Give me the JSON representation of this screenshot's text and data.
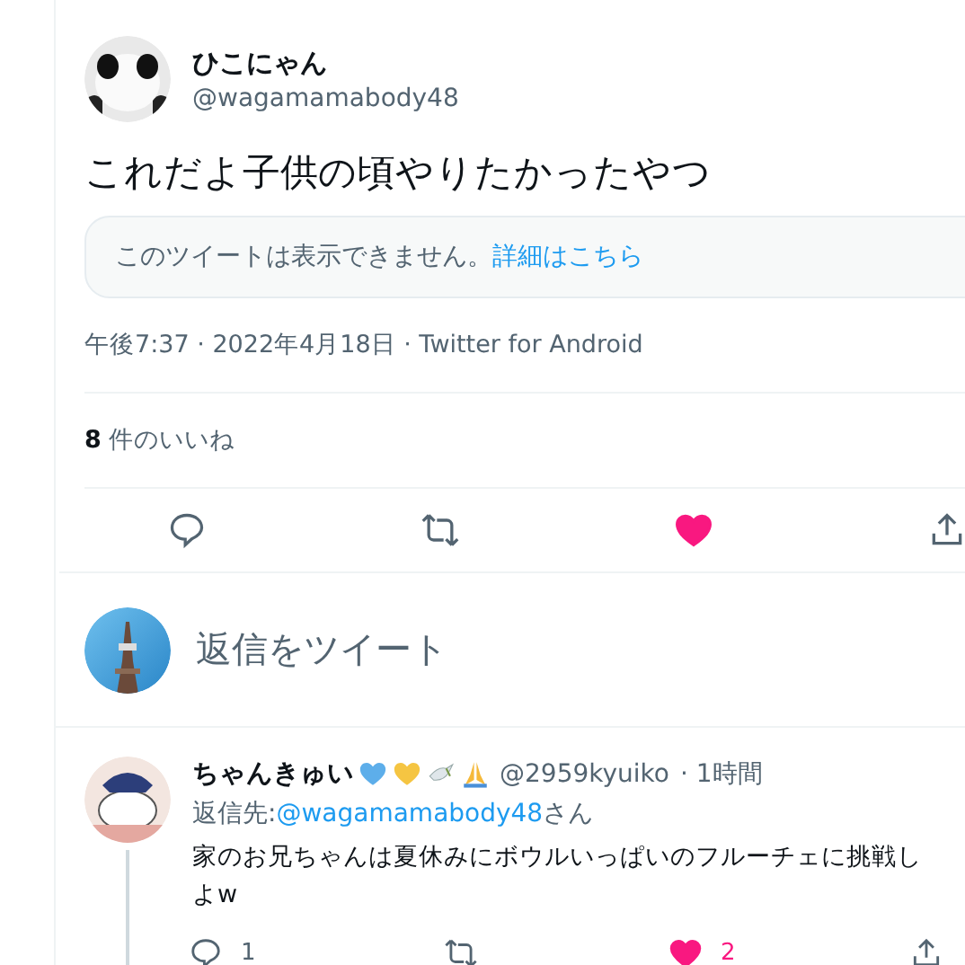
{
  "tweet": {
    "author": {
      "name": "ひこにゃん",
      "handle": "@wagamamabody48"
    },
    "text": "これだよ子供の頃やりたかったやつ",
    "quote_card": {
      "message": "このツイートは表示できません。",
      "link": "詳細はこちら"
    },
    "meta": "午後7:37 · 2022年4月18日 · Twitter for Android",
    "likes": {
      "count": "8",
      "label": "件のいいね"
    },
    "actions": {
      "liked": true
    }
  },
  "composer": {
    "placeholder": "返信をツイート"
  },
  "reply": {
    "author": {
      "name": "ちゃんきゅい",
      "handle": "@2959kyuiko",
      "time": "· 1時間"
    },
    "reply_to": {
      "label": "返信先:",
      "handle": "@wagamamabody48",
      "suffix": "さん"
    },
    "lines": [
      "家のお兄ちゃんは夏休みにボウルいっぱいのフルーチェに挑戦し",
      "よw"
    ],
    "actions": {
      "replies": "1",
      "likes": "2",
      "liked": true
    }
  }
}
